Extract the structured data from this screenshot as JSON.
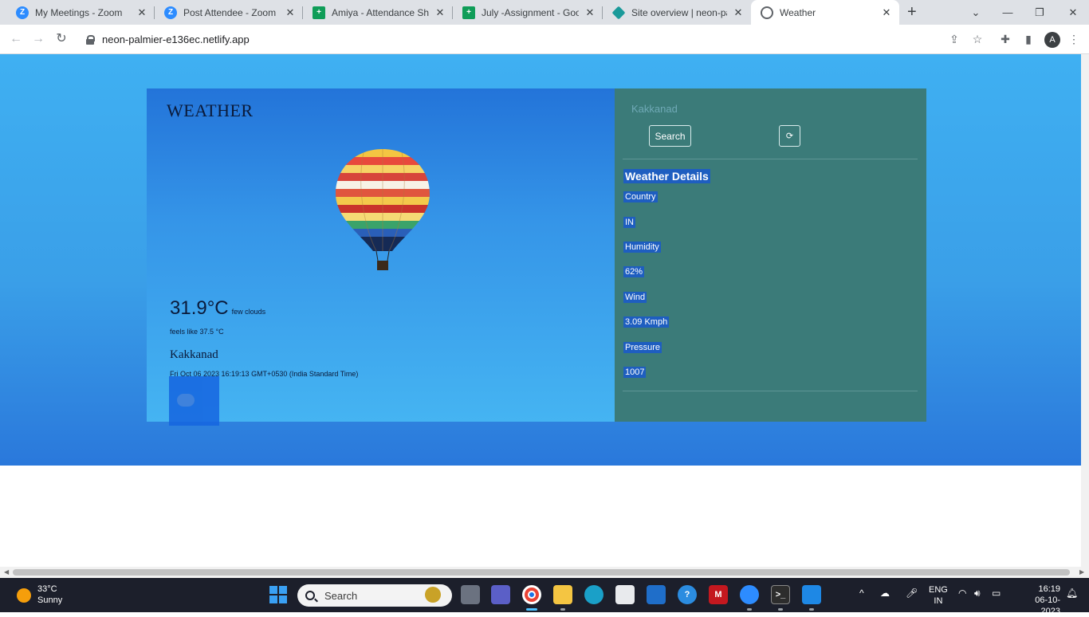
{
  "browser": {
    "tabs": [
      {
        "title": "My Meetings - Zoom",
        "icon": "zoom-icon"
      },
      {
        "title": "Post Attendee - Zoom",
        "icon": "zoom-icon"
      },
      {
        "title": "Amiya - Attendance Sheet",
        "icon": "sheets-icon"
      },
      {
        "title": "July -Assignment - Google",
        "icon": "sheets-icon"
      },
      {
        "title": "Site overview | neon-palmi",
        "icon": "netlify-icon"
      },
      {
        "title": "Weather",
        "icon": "globe-icon",
        "active": true
      }
    ],
    "url": "neon-palmier-e136ec.netlify.app",
    "profile_initial": "A"
  },
  "page": {
    "brand": "WEATHER",
    "temperature": "31.9°C",
    "condition": "few clouds",
    "feels_like": "feels like 37.5 °C",
    "city": "Kakkanad",
    "datetime": "Fri Oct 06 2023 16:19:13 GMT+0530 (India Standard Time)",
    "search": {
      "value": "Kakkanad",
      "button_label": "Search",
      "refresh_label": "⟳"
    },
    "details": {
      "heading": "Weather Details",
      "country_label": "Country",
      "country_value": "IN",
      "humidity_label": "Humidity",
      "humidity_value": "62%",
      "wind_label": "Wind",
      "wind_value": "3.09 Kmph",
      "pressure_label": "Pressure",
      "pressure_value": "1007"
    }
  },
  "taskbar": {
    "weather_temp": "33°C",
    "weather_cond": "Sunny",
    "search_placeholder": "Search",
    "lang_line1": "ENG",
    "lang_line2": "IN",
    "time": "16:19",
    "date": "06-10-2023"
  }
}
